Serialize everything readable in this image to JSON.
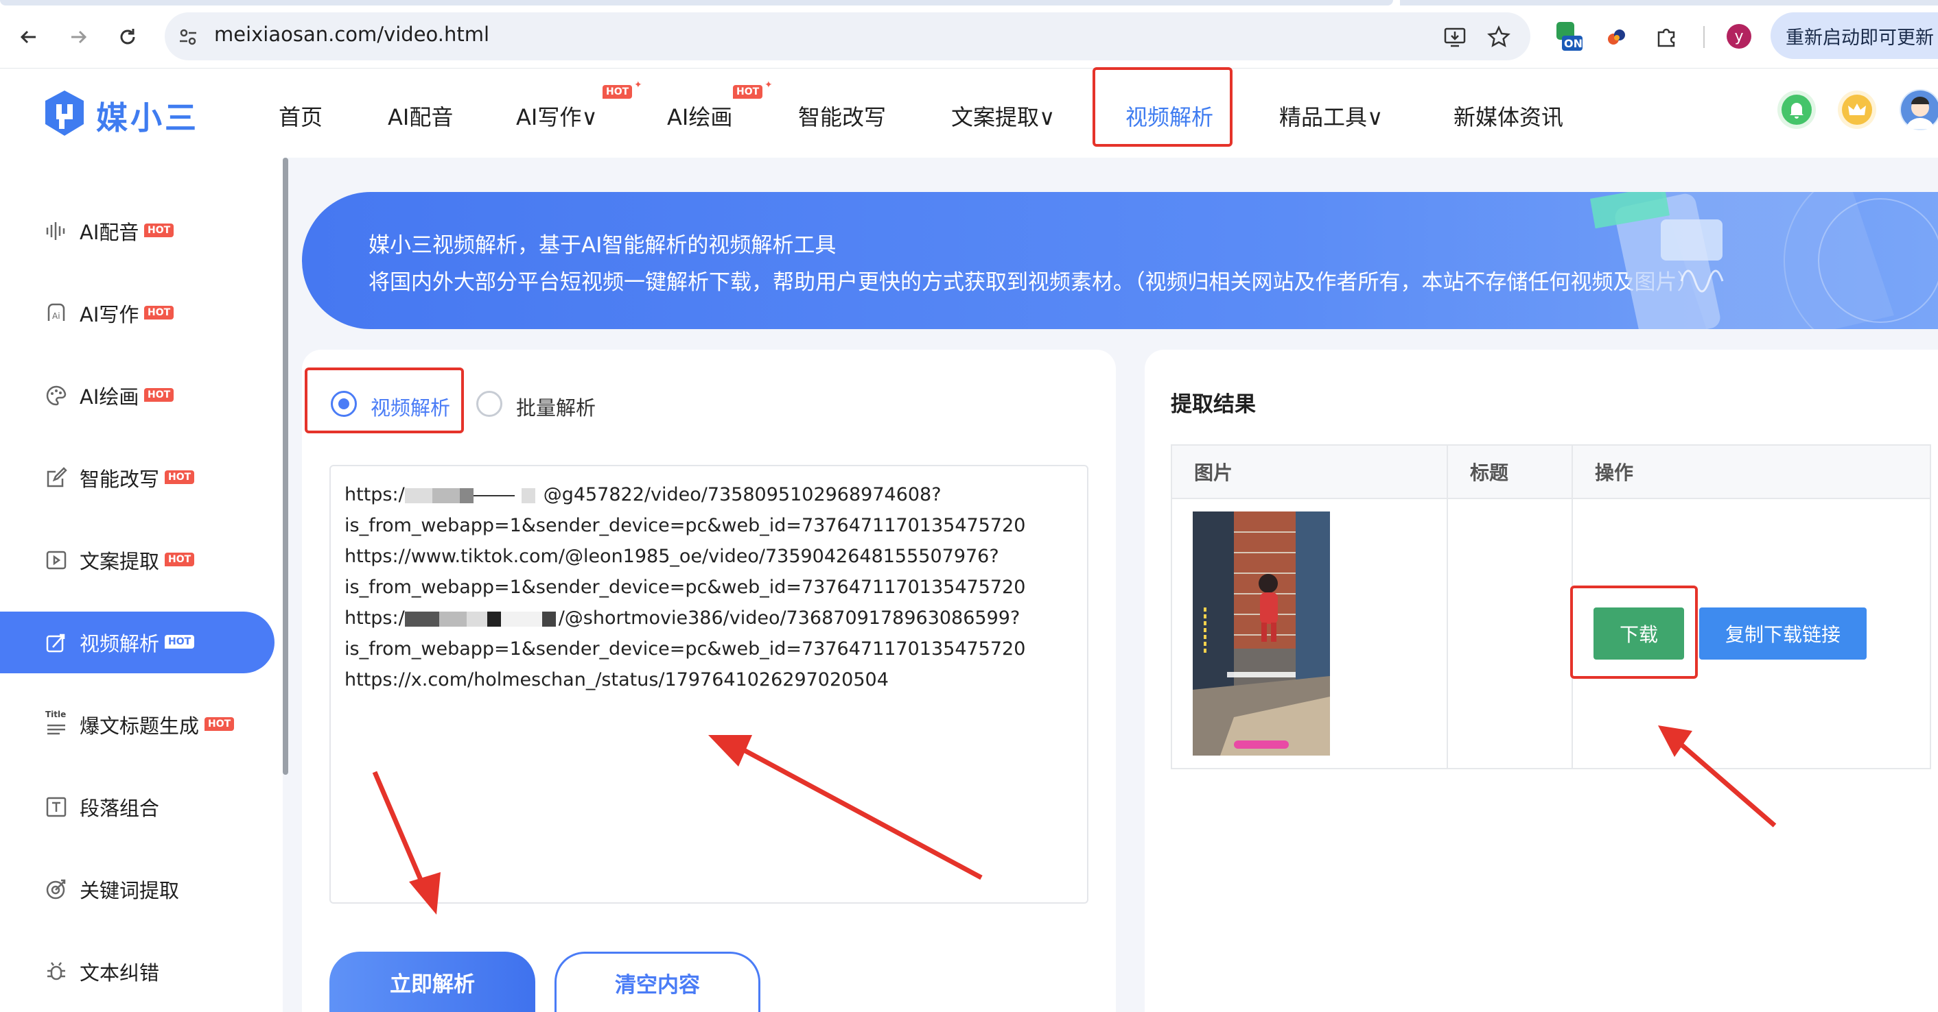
{
  "browser": {
    "url": "meixiaosan.com/video.html",
    "update_label": "重新启动即可更新",
    "profile_initial": "y",
    "extension_badge": "ON"
  },
  "site": {
    "logo_text": "媒小三",
    "nav": [
      {
        "label": "首页"
      },
      {
        "label": "AI配音"
      },
      {
        "label": "AI写作∨",
        "hot": "HOT"
      },
      {
        "label": "AI绘画",
        "hot": "HOT"
      },
      {
        "label": "智能改写"
      },
      {
        "label": "文案提取∨"
      },
      {
        "label": "视频解析"
      },
      {
        "label": "精品工具∨"
      },
      {
        "label": "新媒体资讯"
      }
    ]
  },
  "sidebar": {
    "items": [
      {
        "label": "AI配音",
        "hot": "HOT"
      },
      {
        "label": "AI写作",
        "hot": "HOT"
      },
      {
        "label": "AI绘画",
        "hot": "HOT"
      },
      {
        "label": "智能改写",
        "hot": "HOT"
      },
      {
        "label": "文案提取",
        "hot": "HOT"
      },
      {
        "label": "视频解析",
        "hot": "HOT"
      },
      {
        "label": "爆文标题生成",
        "hot": "HOT"
      },
      {
        "label": "段落组合"
      },
      {
        "label": "关键词提取"
      },
      {
        "label": "文本纠错"
      }
    ],
    "title_icon_text": "Title"
  },
  "banner": {
    "line1": "媒小三视频解析，基于AI智能解析的视频解析工具",
    "line2": "将国内外大部分平台短视频一键解析下载，帮助用户更快的方式获取到视频素材。（视频归相关网站及作者所有，本站不存储任何视频及图片）"
  },
  "parse": {
    "mode_single": "视频解析",
    "mode_batch": "批量解析",
    "lines": [
      {
        "prefix": "https:/",
        "suffix": "@g457822/video/7358095102968974608?"
      },
      {
        "text": "is_from_webapp=1&sender_device=pc&web_id=7376471170135475720"
      },
      {
        "text": "https://www.tiktok.com/@leon1985_oe/video/7359042648155507976?"
      },
      {
        "text": "is_from_webapp=1&sender_device=pc&web_id=7376471170135475720"
      },
      {
        "prefix": "https:/",
        "suffix": "/@shortmovie386/video/7368709178963086599?"
      },
      {
        "text": "is_from_webapp=1&sender_device=pc&web_id=7376471170135475720"
      },
      {
        "text": "https://x.com/holmeschan_/status/1797641026297020504"
      }
    ],
    "parse_button": "立即解析",
    "clear_button": "清空内容"
  },
  "result": {
    "title": "提取结果",
    "columns": [
      "图片",
      "标题",
      "操作"
    ],
    "row": {
      "download_label": "下载",
      "copy_label": "复制下载链接"
    }
  }
}
